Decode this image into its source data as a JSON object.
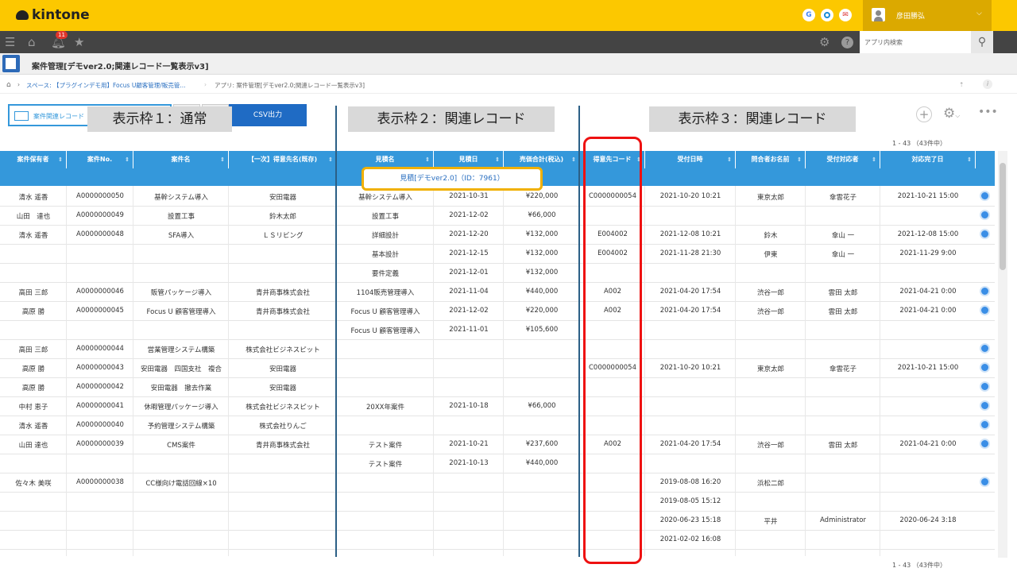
{
  "header": {
    "logo": "kintone",
    "user_name": "彦田勝弘",
    "g_labels": [
      "G",
      "",
      "✉"
    ]
  },
  "nav": {
    "notification_count": "11",
    "search_placeholder": "アプリ内検索"
  },
  "app": {
    "title": "案件管理[デモver2.0;関連レコード一覧表示v3]"
  },
  "breadcrumb": {
    "space": "スペース: 【プラグインデモ用】Focus U顧客管理/販売管...",
    "app": "アプリ: 案件管理[デモver2.0;関連レコード一覧表示v3]"
  },
  "toolbar": {
    "view_label": "案件関連レコード",
    "csv_label": "CSV出力",
    "panel1": "表示枠１：通常",
    "panel2": "表示枠２：関連レコード",
    "panel3": "表示枠３：関連レコード",
    "count": "1 - 43 （43件中）"
  },
  "columns": [
    "案件保有者",
    "案件No.",
    "案件名",
    "【一次】得意先名(既存)",
    "見積名",
    "見積日",
    "売価合計(税込)",
    "得意先コード",
    "受付日時",
    "問合者お名前",
    "受付対応者",
    "対応完了日"
  ],
  "subheader": "見積[デモver2.0]（ID：7961）",
  "rows": [
    {
      "c": [
        "清水 遥香",
        "A0000000050",
        "基幹システム導入",
        "安田電器",
        "基幹システム導入",
        "2021-10-31",
        "¥220,000",
        "C0000000054",
        "2021-10-20 10:21",
        "東京太郎",
        "傘雲花子",
        "2021-10-21 15:00"
      ],
      "dot": true
    },
    {
      "c": [
        "山田　達也",
        "A0000000049",
        "設置工事",
        "鈴木太郎",
        "設置工事",
        "2021-12-02",
        "¥66,000",
        "",
        "",
        "",
        "",
        ""
      ],
      "dot": true
    },
    {
      "c": [
        "清水 遥香",
        "A0000000048",
        "SFA導入",
        "ＬＳリビング",
        "詳細設計",
        "2021-12-20",
        "¥132,000",
        "E004002",
        "2021-12-08 10:21",
        "鈴木",
        "傘山 一",
        "2021-12-08 15:00"
      ],
      "dot": true
    },
    {
      "c": [
        "",
        "",
        "",
        "",
        "基本設計",
        "2021-12-15",
        "¥132,000",
        "E004002",
        "2021-11-28 21:30",
        "伊東",
        "傘山 一",
        "2021-11-29 9:00"
      ],
      "dot": false
    },
    {
      "c": [
        "",
        "",
        "",
        "",
        "要件定義",
        "2021-12-01",
        "¥132,000",
        "",
        "",
        "",
        "",
        ""
      ],
      "dot": false
    },
    {
      "c": [
        "高田 三郎",
        "A0000000046",
        "販管パッケージ導入",
        "青井商事株式会社",
        "1104販売管理導入",
        "2021-11-04",
        "¥440,000",
        "A002",
        "2021-04-20 17:54",
        "渋谷一郎",
        "雲田 太郎",
        "2021-04-21 0:00"
      ],
      "dot": true
    },
    {
      "c": [
        "高原 勝",
        "A0000000045",
        "Focus U 顧客管理導入",
        "青井商事株式会社",
        "Focus U 顧客管理導入",
        "2021-12-02",
        "¥220,000",
        "A002",
        "2021-04-20 17:54",
        "渋谷一郎",
        "雲田 太郎",
        "2021-04-21 0:00"
      ],
      "dot": true
    },
    {
      "c": [
        "",
        "",
        "",
        "",
        "Focus U 顧客管理導入",
        "2021-11-01",
        "¥105,600",
        "",
        "",
        "",
        "",
        ""
      ],
      "dot": false
    },
    {
      "c": [
        "高田 三郎",
        "A0000000044",
        "営業管理システム構築",
        "株式会社ビジネスピット",
        "",
        "",
        "",
        "",
        "",
        "",
        "",
        ""
      ],
      "dot": true
    },
    {
      "c": [
        "高原 勝",
        "A0000000043",
        "安田電器　四国支社　複合",
        "安田電器",
        "",
        "",
        "",
        "C0000000054",
        "2021-10-20 10:21",
        "東京太郎",
        "傘雲花子",
        "2021-10-21 15:00"
      ],
      "dot": true
    },
    {
      "c": [
        "高原 勝",
        "A0000000042",
        "安田電器　撤去作業",
        "安田電器",
        "",
        "",
        "",
        "",
        "",
        "",
        "",
        ""
      ],
      "dot": true
    },
    {
      "c": [
        "中村 恵子",
        "A0000000041",
        "休暇管理パッケージ導入",
        "株式会社ビジネスピット",
        "20XX年案件",
        "2021-10-18",
        "¥66,000",
        "",
        "",
        "",
        "",
        ""
      ],
      "dot": true
    },
    {
      "c": [
        "清水 遥香",
        "A0000000040",
        "予約管理システム構築",
        "株式会社りんご",
        "",
        "",
        "",
        "",
        "",
        "",
        "",
        ""
      ],
      "dot": true
    },
    {
      "c": [
        "山田 達也",
        "A0000000039",
        "CMS案件",
        "青井商事株式会社",
        "テスト案件",
        "2021-10-21",
        "¥237,600",
        "A002",
        "2021-04-20 17:54",
        "渋谷一郎",
        "雲田 太郎",
        "2021-04-21 0:00"
      ],
      "dot": true
    },
    {
      "c": [
        "",
        "",
        "",
        "",
        "テスト案件",
        "2021-10-13",
        "¥440,000",
        "",
        "",
        "",
        "",
        ""
      ],
      "dot": false
    },
    {
      "c": [
        "佐々木 美咲",
        "A0000000038",
        "CC様向け電話回線×10",
        "",
        "",
        "",
        "",
        "",
        "2019-08-08 16:20",
        "浜松二郎",
        "",
        ""
      ],
      "dot": true
    },
    {
      "c": [
        "",
        "",
        "",
        "",
        "",
        "",
        "",
        "",
        "2019-08-05 15:12",
        "",
        "",
        ""
      ],
      "dot": false
    },
    {
      "c": [
        "",
        "",
        "",
        "",
        "",
        "",
        "",
        "",
        "2020-06-23 15:18",
        "平井",
        "Administrator",
        "2020-06-24 3:18"
      ],
      "dot": false
    },
    {
      "c": [
        "",
        "",
        "",
        "",
        "",
        "",
        "",
        "",
        "2021-02-02 16:08",
        "",
        "",
        ""
      ],
      "dot": false
    }
  ]
}
